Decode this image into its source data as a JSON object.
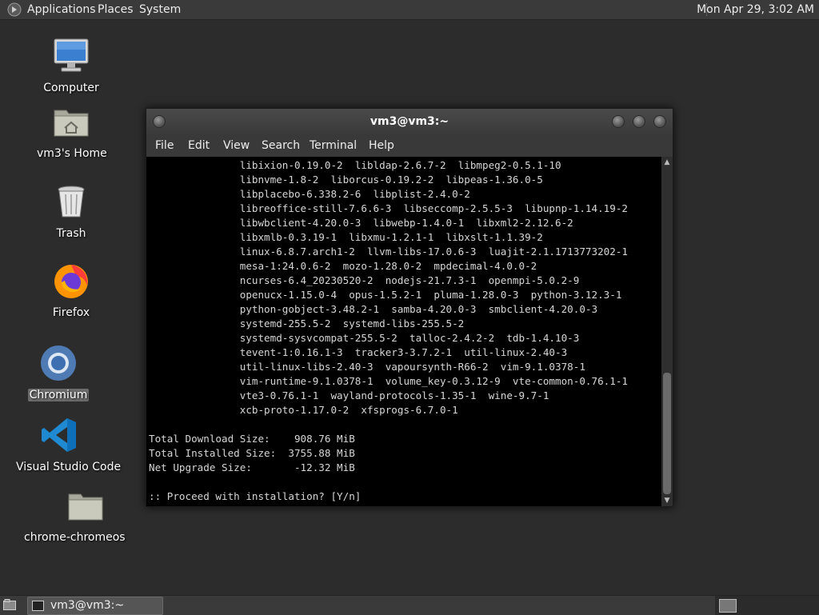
{
  "top_panel": {
    "menus": [
      "Applications",
      "Places",
      "System"
    ],
    "clock": "Mon Apr 29,  3:02 AM"
  },
  "desktop": {
    "icons": [
      {
        "label": "Computer",
        "icon": "computer-icon"
      },
      {
        "label": "vm3's Home",
        "icon": "home-folder-icon"
      },
      {
        "label": "Trash",
        "icon": "trash-icon"
      },
      {
        "label": "Firefox",
        "icon": "firefox-icon"
      },
      {
        "label": "Chromium",
        "icon": "chromium-icon",
        "selected": true
      },
      {
        "label": "Visual Studio Code",
        "icon": "vscode-icon"
      },
      {
        "label": "chrome-chromeos",
        "icon": "folder-icon"
      }
    ]
  },
  "terminal": {
    "title": "vm3@vm3:~",
    "menu": [
      "File",
      "Edit",
      "View",
      "Search",
      "Terminal",
      "Help"
    ],
    "lines": [
      "               libixion-0.19.0-2  libldap-2.6.7-2  libmpeg2-0.5.1-10",
      "               libnvme-1.8-2  liborcus-0.19.2-2  libpeas-1.36.0-5",
      "               libplacebo-6.338.2-6  libplist-2.4.0-2",
      "               libreoffice-still-7.6.6-3  libseccomp-2.5.5-3  libupnp-1.14.19-2",
      "               libwbclient-4.20.0-3  libwebp-1.4.0-1  libxml2-2.12.6-2",
      "               libxmlb-0.3.19-1  libxmu-1.2.1-1  libxslt-1.1.39-2",
      "               linux-6.8.7.arch1-2  llvm-libs-17.0.6-3  luajit-2.1.1713773202-1",
      "               mesa-1:24.0.6-2  mozo-1.28.0-2  mpdecimal-4.0.0-2",
      "               ncurses-6.4_20230520-2  nodejs-21.7.3-1  openmpi-5.0.2-9",
      "               openucx-1.15.0-4  opus-1.5.2-1  pluma-1.28.0-3  python-3.12.3-1",
      "               python-gobject-3.48.2-1  samba-4.20.0-3  smbclient-4.20.0-3",
      "               systemd-255.5-2  systemd-libs-255.5-2",
      "               systemd-sysvcompat-255.5-2  talloc-2.4.2-2  tdb-1.4.10-3",
      "               tevent-1:0.16.1-3  tracker3-3.7.2-1  util-linux-2.40-3",
      "               util-linux-libs-2.40-3  vapoursynth-R66-2  vim-9.1.0378-1",
      "               vim-runtime-9.1.0378-1  volume_key-0.3.12-9  vte-common-0.76.1-1",
      "               vte3-0.76.1-1  wayland-protocols-1.35-1  wine-9.7-1",
      "               xcb-proto-1.17.0-2  xfsprogs-6.7.0-1",
      "",
      "Total Download Size:    908.76 MiB",
      "Total Installed Size:  3755.88 MiB",
      "Net Upgrade Size:       -12.32 MiB",
      "",
      ":: Proceed with installation? [Y/n]"
    ]
  },
  "bottom_panel": {
    "task_label": "vm3@vm3:~"
  }
}
